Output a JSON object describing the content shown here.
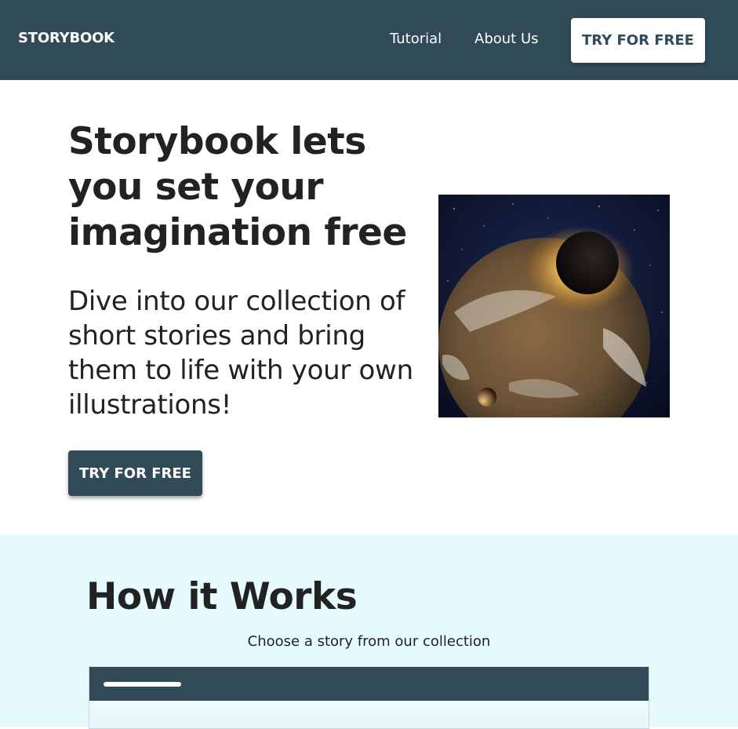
{
  "navbar": {
    "brand": "STORYBOOK",
    "links": [
      "Tutorial",
      "About Us"
    ],
    "cta_label": "TRY FOR FREE",
    "background_color": "#304a57"
  },
  "hero": {
    "title": "Storybook lets you set your imagination free",
    "subtitle": "Dive into our collection of short stories and bring them to life with your own illustrations!",
    "cta_label": "TRY FOR FREE",
    "image_subject": "planet-collision-space-illustration"
  },
  "how_it_works": {
    "title": "How it Works",
    "step_text": "Choose a story from our collection",
    "background_color": "#e6fbfe"
  }
}
